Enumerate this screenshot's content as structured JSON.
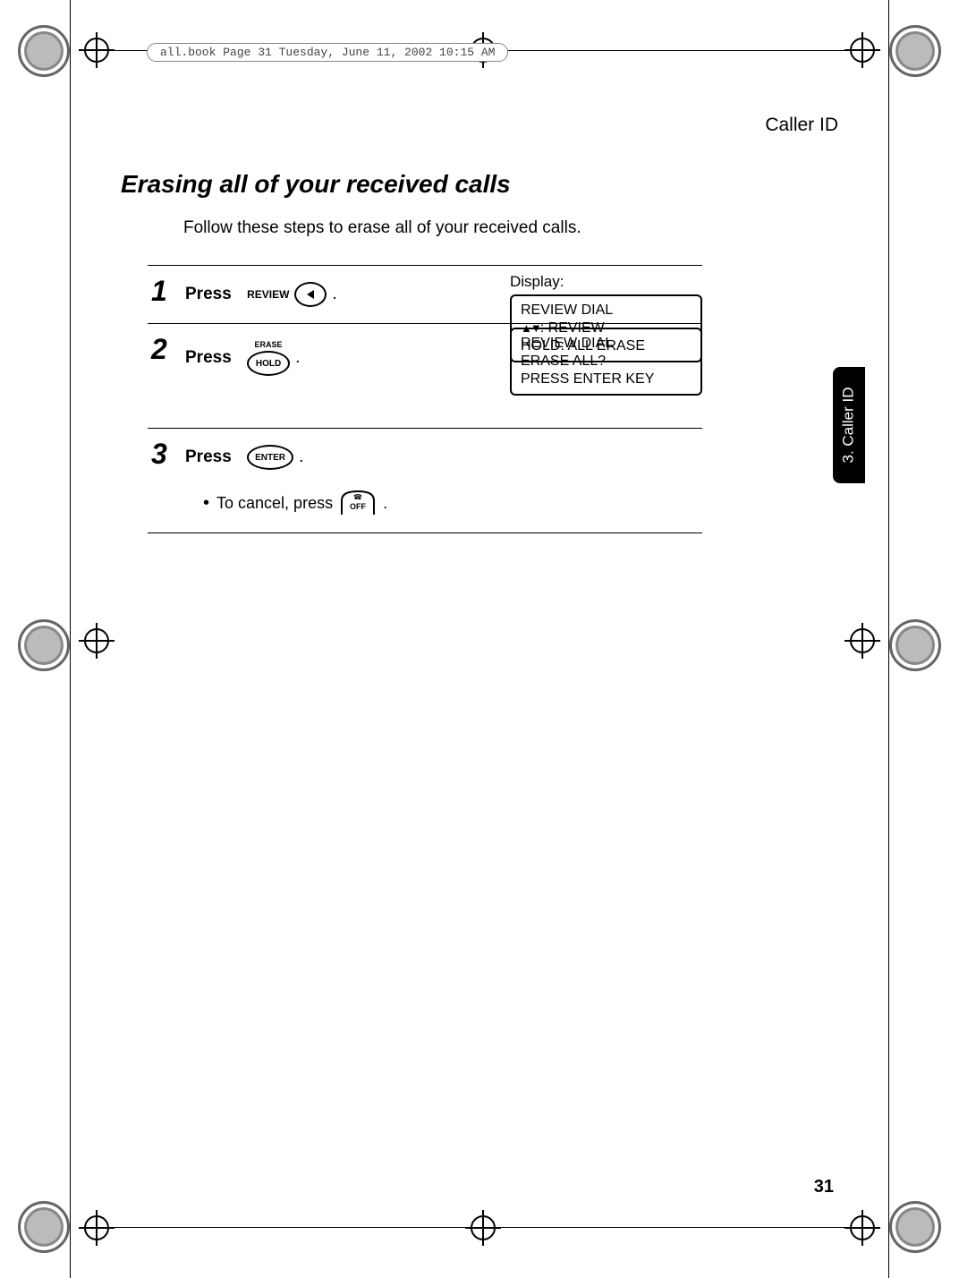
{
  "running_head": "Caller ID",
  "page_header_meta": "all.book  Page 31  Tuesday, June 11, 2002  10:15 AM",
  "section_title": "Erasing all of your received calls",
  "intro_text": "Follow these steps to erase all of your received calls.",
  "side_tab": "3. Caller ID",
  "page_number": "31",
  "steps": [
    {
      "num": "1",
      "press_label": "Press",
      "key_text": "REVIEW",
      "key_icon": "left-triangle",
      "period": ".",
      "display_title": "Display:",
      "lcd_line1": "REVIEW DIAL",
      "lcd_line2_prefix_icons": "▲▼",
      "lcd_line2_rest": ": REVIEW",
      "lcd_line3": "HOLD: ALL ERASE"
    },
    {
      "num": "2",
      "press_label": "Press",
      "key_top_label": "ERASE",
      "key_text": "HOLD",
      "period": ".",
      "lcd_line1": "REVIEW DIAL",
      "lcd_line2": "ERASE ALL?",
      "lcd_line3": "PRESS ENTER KEY"
    },
    {
      "num": "3",
      "press_label": "Press",
      "key_text": "ENTER",
      "period": ".",
      "bullet_text": "To cancel, press",
      "cancel_key_label": "OFF",
      "bullet_period": "."
    }
  ]
}
